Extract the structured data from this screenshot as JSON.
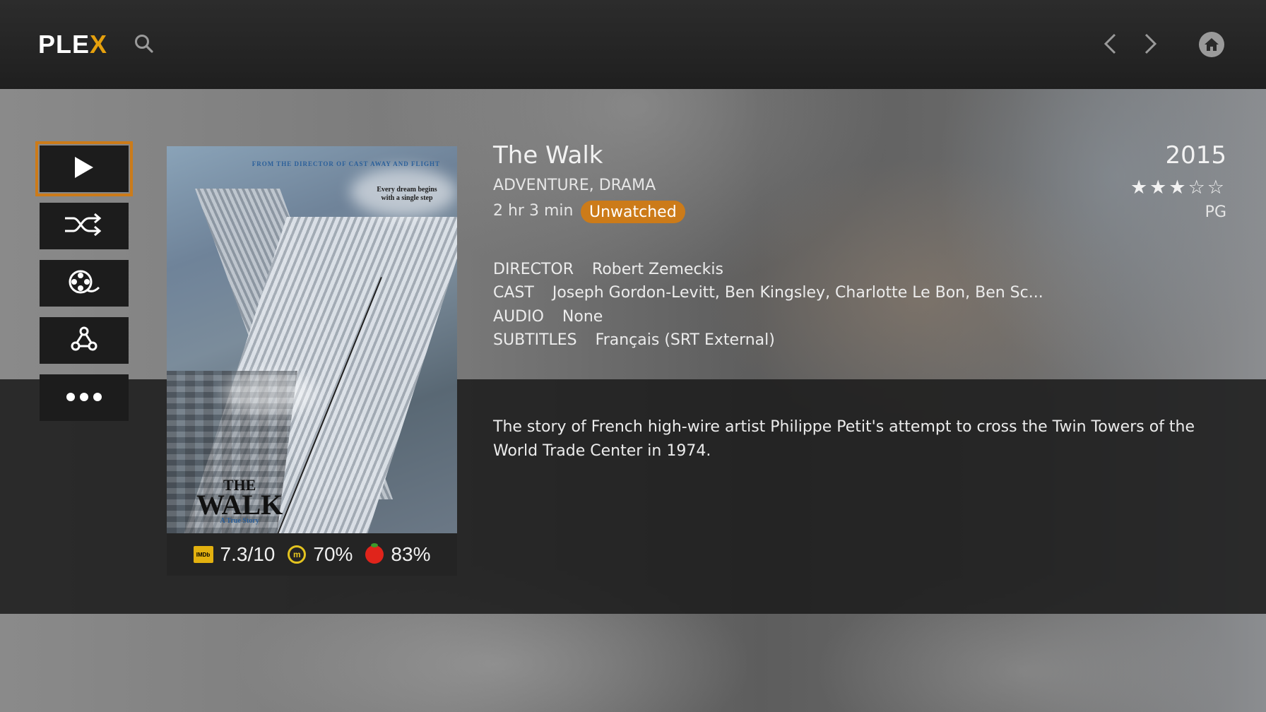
{
  "app": {
    "logo_main": "PLE",
    "logo_x": "X",
    "accent_color": "#cc7b19"
  },
  "header": {
    "search_icon": "search-icon",
    "back_icon": "chevron-left-icon",
    "forward_icon": "chevron-right-icon",
    "home_icon": "home-icon"
  },
  "actions": [
    {
      "name": "play",
      "icon": "play-icon",
      "focused": true
    },
    {
      "name": "shuffle",
      "icon": "shuffle-icon"
    },
    {
      "name": "trailer",
      "icon": "film-reel-icon"
    },
    {
      "name": "related",
      "icon": "related-icon"
    },
    {
      "name": "more",
      "icon": "more-icon"
    }
  ],
  "poster": {
    "top_text": "FROM THE DIRECTOR OF CAST AWAY AND FLIGHT",
    "tagline": "Every dream begins with a single step",
    "title_line1": "THE",
    "title_line2": "WALK",
    "subtitle": "A True Story"
  },
  "ratings": {
    "imdb_label": "IMDb",
    "imdb": "7.3/10",
    "metacritic": "70%",
    "rotten_tomatoes": "83%"
  },
  "movie": {
    "title": "The Walk",
    "genres": "ADVENTURE, DRAMA",
    "duration": "2 hr 3 min",
    "status": "Unwatched",
    "year": "2015",
    "rating_stars": "★★★☆☆",
    "star_rating_value": 3,
    "content_rating": "PG"
  },
  "details": {
    "director_label": "DIRECTOR",
    "director": "Robert Zemeckis",
    "cast_label": "CAST",
    "cast": "Joseph Gordon-Levitt, Ben Kingsley, Charlotte Le Bon, Ben Sc...",
    "audio_label": "AUDIO",
    "audio": "None",
    "subtitles_label": "SUBTITLES",
    "subtitles": "Français (SRT External)"
  },
  "summary": "The story of French high-wire artist Philippe Petit's attempt to cross the Twin Towers of the World Trade Center in 1974."
}
